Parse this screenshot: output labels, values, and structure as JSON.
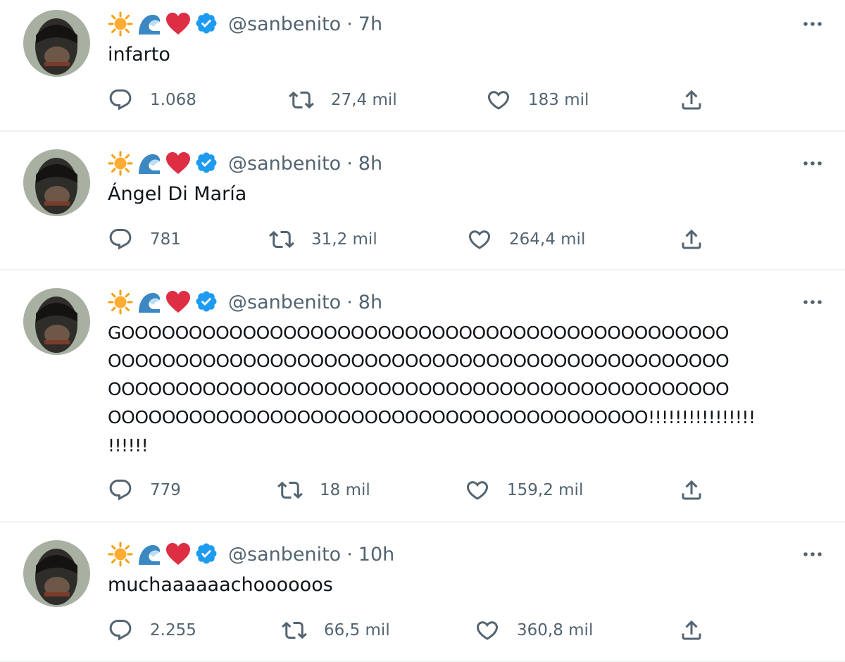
{
  "profile": {
    "emojis": [
      "sun-emoji",
      "wave-emoji",
      "red-heart-emoji"
    ],
    "verified_badge": "verified-badge-icon",
    "handle": "@sanbenito",
    "separator": "·"
  },
  "tweets": [
    {
      "time": "7h",
      "text": "infarto",
      "replies": "1.068",
      "retweets": "27,4 mil",
      "likes": "183 mil"
    },
    {
      "time": "8h",
      "text": "Ángel Di María",
      "replies": "781",
      "retweets": "31,2 mil",
      "likes": "264,4 mil"
    },
    {
      "time": "8h",
      "text": "GOOOOOOOOOOOOOOOOOOOOOOOOOOOOOOOOOOOOOOOOOOOOO\nOOOOOOOOOOOOOOOOOOOOOOOOOOOOOOOOOOOOOOOOOOOOOO\nOOOOOOOOOOOOOOOOOOOOOOOOOOOOOOOOOOOOOOOOOOOOOO\nOOOOOOOOOOOOOOOOOOOOOOOOOOOOOOOOOOOOOOOO!!!!!!!!!!!!!!!!\n!!!!!!",
      "replies": "779",
      "retweets": "18 mil",
      "likes": "159,2 mil"
    },
    {
      "time": "10h",
      "text": "muchaaaaaachoooooos",
      "replies": "2.255",
      "retweets": "66,5 mil",
      "likes": "360,8 mil"
    }
  ],
  "icons": {
    "more": "more-horizontal-icon",
    "reply": "reply-bubble-icon",
    "retweet": "retweet-icon",
    "like": "heart-outline-icon",
    "share": "share-upload-icon"
  },
  "colors": {
    "text": "#0f1419",
    "secondary": "#536471",
    "verified": "#1d9bf0",
    "heart": "#e0245e",
    "sun": "#f4a00c",
    "wave": "#3b88c3",
    "divider": "#eff3f4"
  }
}
